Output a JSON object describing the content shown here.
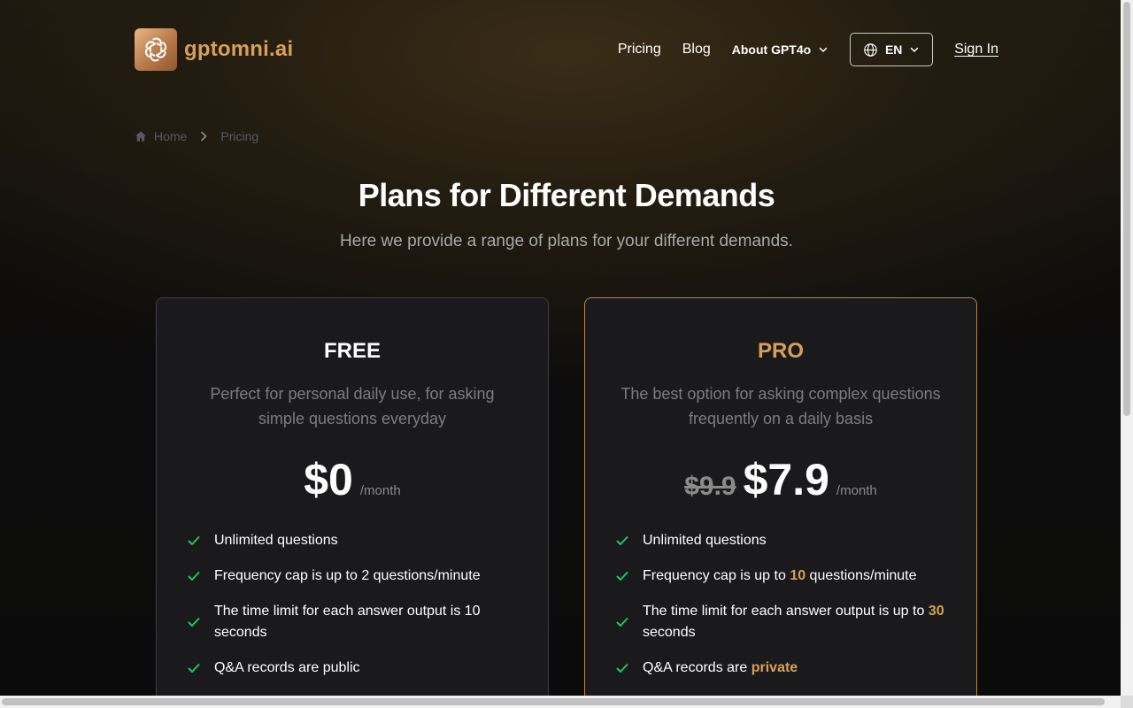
{
  "header": {
    "logo_text": "gptomni.ai",
    "nav": {
      "pricing": "Pricing",
      "blog": "Blog",
      "about": "About GPT4o"
    },
    "language": "EN",
    "sign_in": "Sign In"
  },
  "breadcrumb": {
    "home": "Home",
    "current": "Pricing"
  },
  "hero": {
    "title": "Plans for Different Demands",
    "subtitle": "Here we provide a range of plans for your different demands."
  },
  "plans": [
    {
      "name": "FREE",
      "description": "Perfect for personal daily use, for asking simple questions everyday",
      "price": "$0",
      "period": "/month",
      "features": [
        "Unlimited questions",
        "Frequency cap is up to 2 questions/minute",
        "The time limit for each answer output is 10 seconds",
        "Q&A records are public"
      ]
    },
    {
      "name": "PRO",
      "description": "The best option for asking complex questions frequently on a daily basis",
      "old_price": "$9.9",
      "price": "$7.9",
      "period": "/month",
      "features": [
        {
          "text": "Unlimited questions"
        },
        {
          "before": "Frequency cap is up to ",
          "highlight": "10",
          "after": " questions/minute"
        },
        {
          "before": "The time limit for each answer output is up to ",
          "highlight": "30",
          "after": " seconds"
        },
        {
          "before": "Q&A records are ",
          "highlight": "private",
          "after": ""
        }
      ]
    }
  ],
  "colors": {
    "accent": "#d9a055",
    "check": "#22c55e",
    "card_bg": "#1a1a1c",
    "pro_border": "#b8834a"
  },
  "icons": [
    "openai-logo-icon",
    "chevron-down-icon",
    "globe-icon",
    "home-icon",
    "chevron-right-icon",
    "check-icon"
  ]
}
